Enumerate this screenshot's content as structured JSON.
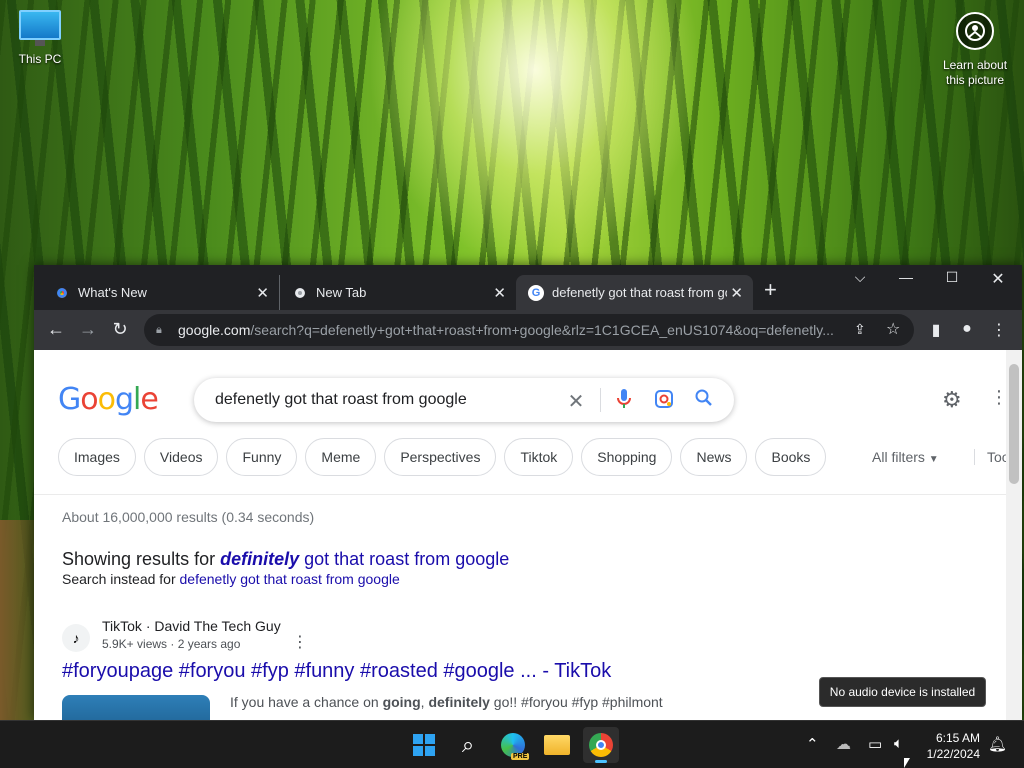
{
  "desktop": {
    "icons": [
      {
        "label": "This PC"
      },
      {
        "label": "Learn about this picture"
      }
    ]
  },
  "browser": {
    "tabs": [
      {
        "title": "What's New",
        "favicon": "chrome-icon"
      },
      {
        "title": "New Tab",
        "favicon": "chrome-icon"
      },
      {
        "title": "defenetly got that roast from go",
        "favicon": "google-icon"
      }
    ],
    "url_host": "google.com",
    "url_rest": "/search?q=defenetly+got+that+roast+from+google&rlz=1C1GCEA_enUS1074&oq=defenetly..."
  },
  "google": {
    "logo": "Google",
    "query": "defenetly got that roast from google",
    "chips": [
      "Images",
      "Videos",
      "Funny",
      "Meme",
      "Perspectives",
      "Tiktok",
      "Shopping",
      "News",
      "Books"
    ],
    "all_filters": "All filters",
    "tools": "Tools",
    "stats": "About 16,000,000 results (0.34 seconds)",
    "showing_prefix": "Showing results for",
    "corrected_bold": "definitely",
    "corrected_rest": "got that roast from google",
    "instead_prefix": "Search instead for",
    "instead_query": "defenetly got that roast from google",
    "result": {
      "source": "TikTok · David The Tech Guy",
      "meta": "5.9K+ views · 2 years ago",
      "title": "#foryoupage #foryou #fyp #funny #roasted #google ... - TikTok",
      "snippet_a": "If you have a chance on ",
      "snippet_b": "going",
      "snippet_c": ", ",
      "snippet_d": "definitely",
      "snippet_e": " go!! #foryou #fyp #philmont"
    }
  },
  "toast": "No audio device is installed",
  "taskbar": {
    "time": "6:15 AM",
    "date": "1/22/2024",
    "apps": [
      "start",
      "search",
      "edge-pre",
      "file-explorer",
      "chrome"
    ]
  },
  "colors": {
    "link": "#1a0dab",
    "chrome_dark": "#202124",
    "toolbar": "#35363a",
    "taskbar": "#1c1c1c"
  }
}
